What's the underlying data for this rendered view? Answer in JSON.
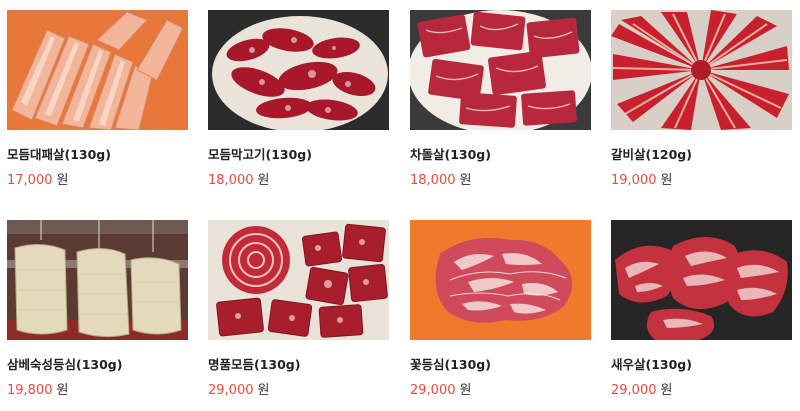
{
  "colors": {
    "price": "#e84b3c",
    "name": "#222222"
  },
  "products": [
    {
      "name": "모듬대패살(130g)",
      "price": "17,000",
      "currency": "원",
      "image": "sliced-frozen-pork-belly"
    },
    {
      "name": "모듬막고기(130g)",
      "price": "18,000",
      "currency": "원",
      "image": "assorted-beef-cuts-plate"
    },
    {
      "name": "차돌살(130g)",
      "price": "18,000",
      "currency": "원",
      "image": "marbled-brisket-slices"
    },
    {
      "name": "갈비살(120g)",
      "price": "19,000",
      "currency": "원",
      "image": "rib-meat-platter"
    },
    {
      "name": "삼베숙성등심(130g)",
      "price": "19,800",
      "currency": "원",
      "image": "hemp-bag-aged-sirloin"
    },
    {
      "name": "명품모듬(130g)",
      "price": "29,000",
      "currency": "원",
      "image": "premium-assorted-beef"
    },
    {
      "name": "꽃등심(130g)",
      "price": "29,000",
      "currency": "원",
      "image": "marbled-ribeye"
    },
    {
      "name": "새우살(130g)",
      "price": "29,000",
      "currency": "원",
      "image": "ribeye-cap-cuts"
    }
  ]
}
